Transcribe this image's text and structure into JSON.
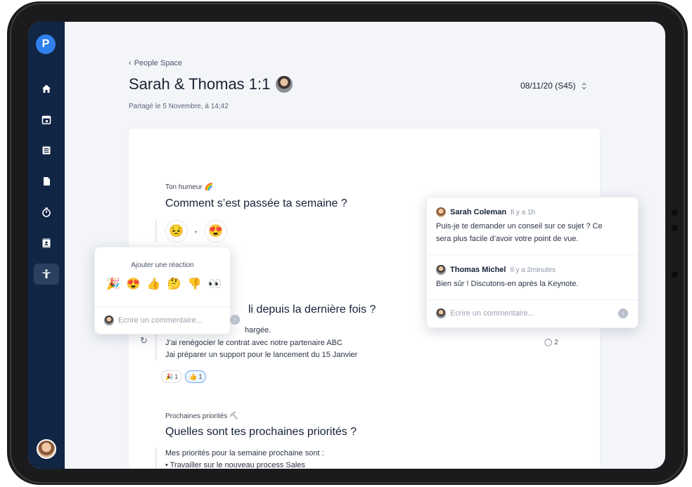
{
  "sidebar": {
    "logo": "P",
    "items": [
      {
        "icon": "home-icon"
      },
      {
        "icon": "calendar-icon"
      },
      {
        "icon": "list-icon"
      },
      {
        "icon": "document-icon"
      },
      {
        "icon": "timer-icon"
      },
      {
        "icon": "contact-card-icon"
      },
      {
        "icon": "person-icon",
        "active": true
      }
    ]
  },
  "breadcrumb": {
    "back_label": "People Space"
  },
  "page": {
    "title": "Sarah & Thomas 1:1",
    "shared": "Partagé le 5 Novembre, à 14;42",
    "date_select": "08/11/20 (S45)"
  },
  "sections": {
    "mood": {
      "label": "Ton humeur 🌈",
      "question": "Comment s’est passée ta semaine ?",
      "from_emoji": "😣",
      "to_emoji": "😍"
    },
    "done": {
      "question_partial": "li depuis la dernière fois ?",
      "line1_partial": "hargée.",
      "line2": "J’ai renégocier le contrat avec notre partenaire ABC",
      "line3": "Jai préparer un support pour le lancement du 15 Janvier",
      "comments_count": "2",
      "reactions": [
        {
          "emoji": "🎉",
          "count": "1"
        },
        {
          "emoji": "👍",
          "count": "1"
        }
      ]
    },
    "priorities": {
      "label": "Prochaines priorités ⛏",
      "question": "Quelles sont tes prochaines priorités ?",
      "line1": "Mes priorités pour la semaine prochaine sont :",
      "line2": "• Travailler sur le nouveau process Sales"
    }
  },
  "reaction_popup": {
    "title": "Ajouter une réaction",
    "emojis": [
      "🎉",
      "😍",
      "👍",
      "🤔",
      "👎",
      "👀"
    ],
    "input_placeholder": "Ecrire un commentaire..."
  },
  "comment_popup": {
    "comments": [
      {
        "author": "Sarah Coleman",
        "time": "Il y a 1h",
        "text_line1": "Puis-je te demander un conseil sur ce sujet ? Ce",
        "text_line2": "sera plus facile d’avoir votre point de vue."
      },
      {
        "author": "Thomas Michel",
        "time": "Il y a 2minutes",
        "text_line1": "Bien sûr ! Discutons-en après la Keynote."
      }
    ],
    "input_placeholder": "Ecrire un commentaire..."
  }
}
